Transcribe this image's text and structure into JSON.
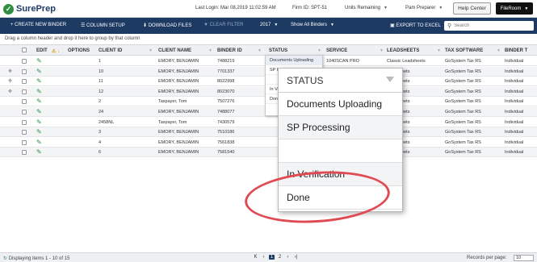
{
  "app": {
    "logo_mark": "✓",
    "logo_text": "SurePrep"
  },
  "topbar": {
    "last_login": "Last Login: Mar 08,2019 11:02:59 AM",
    "firm_id": "Firm ID:  SPT-51",
    "units_remaining": "Units Remaining",
    "user": "Pam Preparer",
    "help_center": "Help Center",
    "fileroom": "FileRoom"
  },
  "navbar": {
    "create_binder": "+ CREATE NEW BINDER",
    "column_setup": "☰ COLUMN SETUP",
    "download_files": "⬇ DOWNLOAD FILES",
    "clear_filter": "▼ CLEAR FILTER",
    "year": "2017",
    "show_binders": "Show All Binders",
    "export_excel": "▣ EXPORT TO EXCEL",
    "search_placeholder": "Search"
  },
  "group_hint": "Drag a column header and drop it here to group by that column",
  "grid": {
    "headers": {
      "edit": "EDIT",
      "warn": "⚠ ↓",
      "options": "OPTIONS",
      "client_id": "CLIENT ID",
      "client_name": "CLIENT NAME",
      "binder_id": "BINDER ID",
      "status": "STATUS",
      "service": "SERVICE",
      "leadsheets": "LEADSHEETS",
      "tax_software": "TAX SOFTWARE",
      "binder_t": "BINDER T"
    },
    "rows": [
      {
        "client_id": "1",
        "client_name": "EMORY, BENJAMIN",
        "binder_id": "7488219",
        "service": "1040SCAN PRO",
        "leadsheets": "Classic Leadsheets",
        "tax_software": "GoSystem Tax RS",
        "binder_t": "Individual",
        "drag": false
      },
      {
        "client_id": "10",
        "client_name": "EMORY, BENJAMIN",
        "binder_id": "7701337",
        "service": "",
        "leadsheets": "Leadsheets",
        "tax_software": "GoSystem Tax RS",
        "binder_t": "Individual",
        "drag": true
      },
      {
        "client_id": "11",
        "client_name": "EMORY, BENJAMIN",
        "binder_id": "8022998",
        "service": "",
        "leadsheets": "Leadsheets",
        "tax_software": "GoSystem Tax RS",
        "binder_t": "Individual",
        "drag": true
      },
      {
        "client_id": "12",
        "client_name": "EMORY, BENJAMIN",
        "binder_id": "8023070",
        "service": "",
        "leadsheets": "Leadsheets",
        "tax_software": "GoSystem Tax RS",
        "binder_t": "Individual",
        "drag": true
      },
      {
        "client_id": "2",
        "client_name": "Taxpayer, Tom",
        "binder_id": "7507276",
        "service": "",
        "leadsheets": "Leadsheets",
        "tax_software": "GoSystem Tax RS",
        "binder_t": "Individual",
        "drag": false
      },
      {
        "client_id": "24",
        "client_name": "EMORY, BENJAMIN",
        "binder_id": "7488077",
        "service": "",
        "leadsheets": "Leadsheets",
        "tax_software": "GoSystem Tax RS",
        "binder_t": "Individual",
        "drag": false
      },
      {
        "client_id": "2458NL",
        "client_name": "Taxpayer, Tom",
        "binder_id": "7430579",
        "service": "",
        "leadsheets": "Leadsheets",
        "tax_software": "GoSystem Tax RS",
        "binder_t": "Individual",
        "drag": false
      },
      {
        "client_id": "3",
        "client_name": "EMORY, BENJAMIN",
        "binder_id": "7510186",
        "service": "",
        "leadsheets": "Leadsheets",
        "tax_software": "GoSystem Tax RS",
        "binder_t": "Individual",
        "drag": false
      },
      {
        "client_id": "4",
        "client_name": "EMORY, BENJAMIN",
        "binder_id": "7561838",
        "service": "",
        "leadsheets": "Leadsheets",
        "tax_software": "GoSystem Tax RS",
        "binder_t": "Individual",
        "drag": false
      },
      {
        "client_id": "6",
        "client_name": "EMORY, BENJAMIN",
        "binder_id": "7581540",
        "service": "",
        "leadsheets": "Leadsheets",
        "tax_software": "GoSystem Tax RS",
        "binder_t": "Individual",
        "drag": false
      }
    ]
  },
  "small_dropdown": {
    "items": [
      "Documents Uploading",
      "SP Pro",
      "",
      "In Ve",
      "Done"
    ]
  },
  "status_dropdown": {
    "title": "STATUS",
    "items": [
      "Documents Uploading",
      "SP Processing",
      "",
      "In Verification",
      "Done"
    ]
  },
  "footer": {
    "displaying": "Displaying items 1 - 10 of 15",
    "first": "K",
    "prev": "‹",
    "page1": "1",
    "page2": "2",
    "next": "›",
    "last": "›|",
    "records_label": "Records per page:",
    "records_value": "10"
  },
  "colors": {
    "navy": "#1d3a63",
    "green": "#2f8f3f",
    "highlight": "#e04a53"
  }
}
